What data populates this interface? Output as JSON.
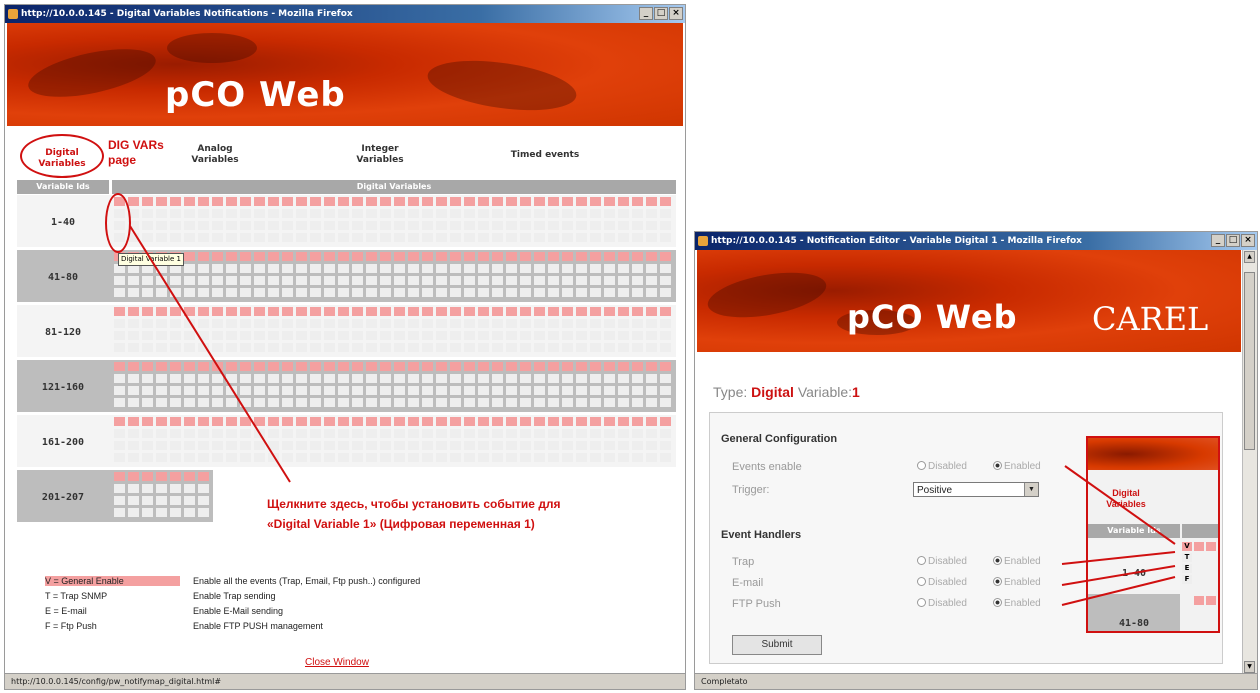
{
  "window1": {
    "title": "http://10.0.0.145 - Digital Variables Notifications - Mozilla Firefox",
    "logo": "pCO Web",
    "nav": {
      "digital": "Digital Variables",
      "analog": "Analog Variables",
      "integer": "Integer Variables",
      "timed": "Timed events"
    },
    "note_page": "DIG VARs page",
    "table": {
      "col1_header": "Variable Ids",
      "col2_header": "Digital Variables",
      "cell_letters": [
        "V",
        "T",
        "E",
        "F"
      ],
      "rows": [
        "1-40",
        "41-80",
        "81-120",
        "121-160",
        "161-200",
        "201-207"
      ]
    },
    "tooltip": "Digital Variable 1",
    "instruction_line1": "Щелкните здесь, чтобы установить событие для",
    "instruction_line2": "«Digital Variable 1» (Цифровая переменная 1)",
    "legend": [
      {
        "key": "V = General Enable",
        "desc": "Enable all the events (Trap, Email, Ftp push..) configured"
      },
      {
        "key": "T = Trap SNMP",
        "desc": "Enable Trap sending"
      },
      {
        "key": "E = E-mail",
        "desc": "Enable E-Mail sending"
      },
      {
        "key": "F = Ftp Push",
        "desc": "Enable FTP PUSH management"
      }
    ],
    "close_link": "Close Window",
    "status": "http://10.0.0.145/config/pw_notifymap_digital.html#"
  },
  "window2": {
    "title": "http://10.0.0.145 - Notification Editor - Variable Digital 1 - Mozilla Firefox",
    "logo": "pCO Web",
    "brand": "CAREL",
    "type_label": "Type:",
    "type_value": "Digital",
    "variable_label": "Variable:",
    "variable_value": "1",
    "general_config": "General Configuration",
    "events_enable": "Events enable",
    "trigger": "Trigger:",
    "trigger_value": "Positive",
    "event_handlers": "Event Handlers",
    "trap": "Trap",
    "email": "E-mail",
    "ftp_push": "FTP Push",
    "disabled": "Disabled",
    "enabled": "Enabled",
    "submit": "Submit",
    "inset_nav": "Digital Variables",
    "inset_header": "Variable Ids",
    "inset_row1": "1-40",
    "inset_row2": "41-80",
    "inset_letters": [
      "V",
      "T",
      "E",
      "F"
    ],
    "status": "Completato"
  },
  "colors": {
    "accent_red": "#d01010",
    "banner_red": "#d83a00",
    "v_row_pink": "#f4a0a0",
    "header_gray": "#a8a8a8"
  }
}
